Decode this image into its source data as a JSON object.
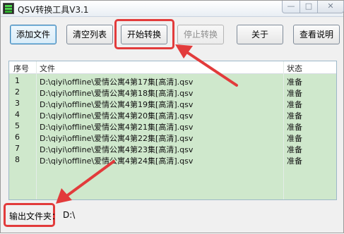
{
  "window": {
    "title": "QSV转换工具V3.1"
  },
  "toolbar": {
    "add_file": "添加文件",
    "clear_list": "清空列表",
    "start": "开始转换",
    "stop": "停止转换",
    "about": "关于",
    "help": "查看说明"
  },
  "list": {
    "headers": {
      "index": "序号",
      "file": "文件",
      "status": "状态"
    },
    "rows": [
      {
        "index": "1",
        "file": "D:\\qiyi\\offline\\爱情公寓4第17集[高清].qsv",
        "status": "准备"
      },
      {
        "index": "2",
        "file": "D:\\qiyi\\offline\\爱情公寓4第18集[高清].qsv",
        "status": "准备"
      },
      {
        "index": "3",
        "file": "D:\\qiyi\\offline\\爱情公寓4第19集[高清].qsv",
        "status": "准备"
      },
      {
        "index": "4",
        "file": "D:\\qiyi\\offline\\爱情公寓4第20集[高清].qsv",
        "status": "准备"
      },
      {
        "index": "5",
        "file": "D:\\qiyi\\offline\\爱情公寓4第21集[高清].qsv",
        "status": "准备"
      },
      {
        "index": "6",
        "file": "D:\\qiyi\\offline\\爱情公寓4第22集[高清].qsv",
        "status": "准备"
      },
      {
        "index": "7",
        "file": "D:\\qiyi\\offline\\爱情公寓4第23集[高清].qsv",
        "status": "准备"
      },
      {
        "index": "8",
        "file": "D:\\qiyi\\offline\\爱情公寓4第24集[高清].qsv",
        "status": "准备"
      }
    ]
  },
  "output": {
    "label": "输出文件夹：",
    "value": "D:\\"
  },
  "colors": {
    "highlight": "#e23b3b",
    "list_bg": "#cfe8cc"
  },
  "icons": [
    "app-icon",
    "minimize-icon",
    "maximize-icon",
    "close-icon",
    "arrow-annotation"
  ]
}
